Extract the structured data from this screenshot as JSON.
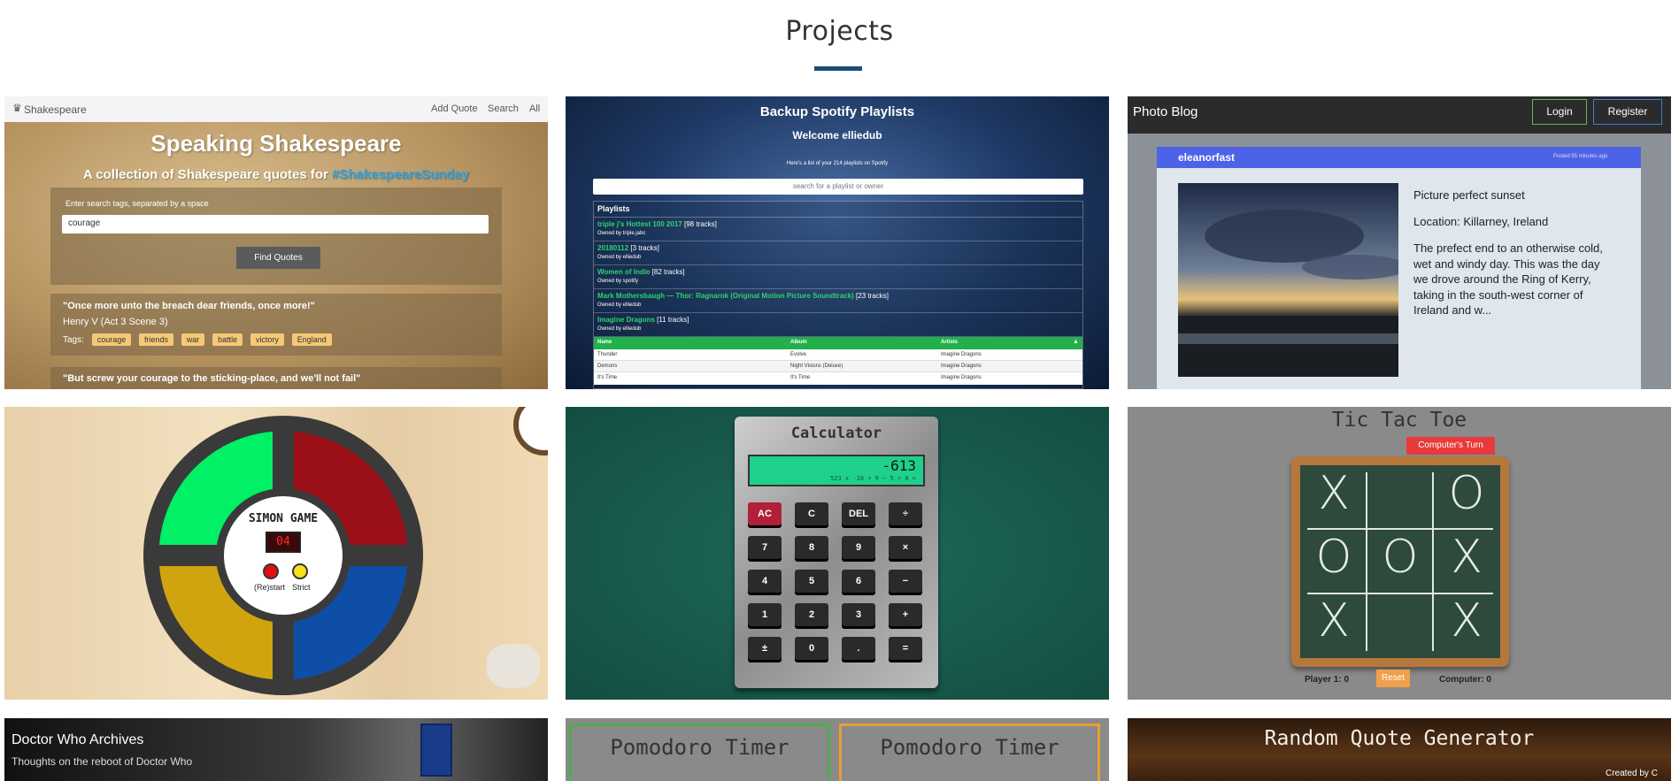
{
  "page": {
    "title": "Projects"
  },
  "shakespeare": {
    "brand": "Shakespeare",
    "nav": [
      "Add Quote",
      "Search",
      "All"
    ],
    "heading": "Speaking Shakespeare",
    "subheading_pre": "A collection of Shakespeare quotes for ",
    "subheading_tag": "#ShakespeareSunday",
    "search_label": "Enter search tags, separated by a space",
    "search_value": "courage",
    "button": "Find Quotes",
    "quote1": "\"Once more unto the breach dear friends, once more!\"",
    "source1": "Henry V  (Act 3 Scene 3)",
    "tags_label": "Tags:",
    "tags": [
      "courage",
      "friends",
      "war",
      "battle",
      "victory",
      "England"
    ],
    "quote2": "\"But screw your courage to the sticking-place, and we'll not fail\""
  },
  "spotify": {
    "heading": "Backup Spotify Playlists",
    "welcome": "Welcome elliedub",
    "subtext": "Here's a list of your 214 playlists on Spotify",
    "search_placeholder": "search for a playlist or owner",
    "playlists_header": "Playlists",
    "playlists": [
      {
        "name": "triple j's Hottest 100 2017",
        "count": "[98 tracks]",
        "owner": "Owned by triple.jabc"
      },
      {
        "name": "20180112",
        "count": "[3 tracks]",
        "owner": "Owned by elliedub"
      },
      {
        "name": "Women of Indie",
        "count": "[82 tracks]",
        "owner": "Owned by spotify"
      },
      {
        "name": "Mark Mothersbaugh — Thor: Ragnarok (Original Motion Picture Soundtrack)",
        "count": "[23 tracks]",
        "owner": "Owned by elliedub"
      },
      {
        "name": "Imagine Dragons",
        "count": "[11 tracks]",
        "owner": "Owned by elliedub"
      }
    ],
    "table_headers": [
      "Name",
      "Album",
      "Artists"
    ],
    "rows": [
      [
        "Thunder",
        "Evolve",
        "Imagine Dragons"
      ],
      [
        "Demons",
        "Night Visions (Deluxe)",
        "Imagine Dragons"
      ],
      [
        "It's Time",
        "It's Time",
        "Imagine Dragons"
      ]
    ]
  },
  "photoblog": {
    "brand": "Photo Blog",
    "login": "Login",
    "register": "Register",
    "user": "eleanorfast",
    "posted": "Posted 55 minutes ago",
    "post_title": "Picture perfect sunset",
    "location": "Location: Killarney, Ireland",
    "body": "The prefect end to an otherwise cold, wet and windy day. This was the day we drove around the Ring of Kerry, taking in the south-west corner of Ireland and w..."
  },
  "simon": {
    "title": "SIMON GAME",
    "count": "04",
    "restart": "(Re)start",
    "strict": "Strict",
    "colors": {
      "green": "#00f066",
      "red": "#9b1018",
      "yellow": "#cfa40e",
      "blue": "#0f4ea6"
    }
  },
  "calculator": {
    "title": "Calculator",
    "display_value": "-613",
    "display_expr": "523 x -10 ÷ 9 − 5 ÷ 8 =",
    "keys": [
      [
        "AC",
        "C",
        "DEL",
        "÷"
      ],
      [
        "7",
        "8",
        "9",
        "×"
      ],
      [
        "4",
        "5",
        "6",
        "−"
      ],
      [
        "1",
        "2",
        "3",
        "+"
      ],
      [
        "±",
        "0",
        ".",
        "="
      ]
    ]
  },
  "tictactoe": {
    "title": "Tic Tac Toe",
    "turn": "Computer's Turn",
    "board": [
      [
        "X",
        "",
        "O"
      ],
      [
        "O",
        "O",
        "X"
      ],
      [
        "X",
        "",
        "X"
      ]
    ],
    "player": "Player 1: 0",
    "reset": "Reset",
    "computer": "Computer: 0"
  },
  "doctorwho": {
    "title": "Doctor Who Archives",
    "subtitle": "Thoughts on the reboot of Doctor Who"
  },
  "pomodoro": {
    "title_left": "Pomodoro Timer",
    "title_right": "Pomodoro Timer"
  },
  "randomquote": {
    "title": "Random Quote Generator",
    "credit": "Created by C"
  }
}
